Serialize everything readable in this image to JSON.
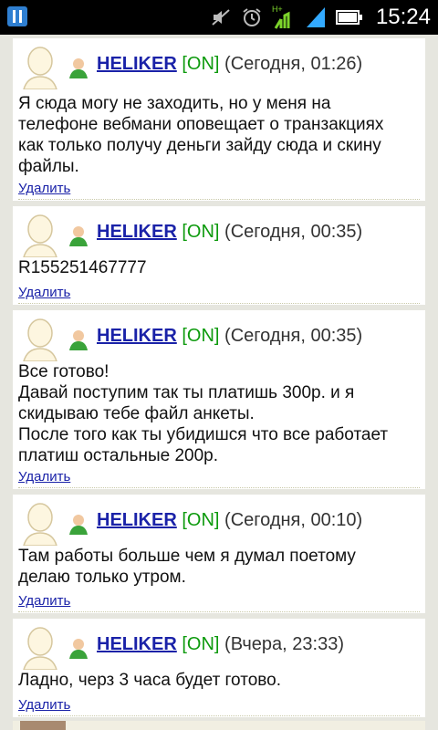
{
  "status_bar": {
    "time": "15:24",
    "network_label": "H+",
    "icons": [
      "app-icon",
      "mute-icon",
      "alarm-icon",
      "signal-icon",
      "battery-icon"
    ]
  },
  "colors": {
    "username": "#1a22a8",
    "online": "#0d9a0d",
    "background": "#e6e6df"
  },
  "posts": [
    {
      "username": "HELIKER",
      "status": "[ON]",
      "timestamp": "(Сегодня, 01:26)",
      "message": "Я сюда могу не заходить, но у меня на\nтелефоне вебмани оповещает о транзакциях\nкак только получу деньги зайду сюда и скину\nфайлы.",
      "delete_label": "Удалить"
    },
    {
      "username": "HELIKER",
      "status": "[ON]",
      "timestamp": "(Сегодня, 00:35)",
      "message": "R155251467777",
      "delete_label": "Удалить"
    },
    {
      "username": "HELIKER",
      "status": "[ON]",
      "timestamp": "(Сегодня, 00:35)",
      "message": "Все готово!\nДавай поступим так ты платишь 300р. и я\nскидываю тебе файл анкеты.\nПосле того как ты убидишся что все работает\nплатиш остальные 200р.",
      "delete_label": "Удалить"
    },
    {
      "username": "HELIKER",
      "status": "[ON]",
      "timestamp": "(Сегодня, 00:10)",
      "message": "Там работы больше чем я думал поетому\nделаю только утром.",
      "delete_label": "Удалить"
    },
    {
      "username": "HELIKER",
      "status": "[ON]",
      "timestamp": "(Вчера, 23:33)",
      "message": "Ладно, черз 3 часа будет готово.",
      "delete_label": "Удалить"
    }
  ]
}
